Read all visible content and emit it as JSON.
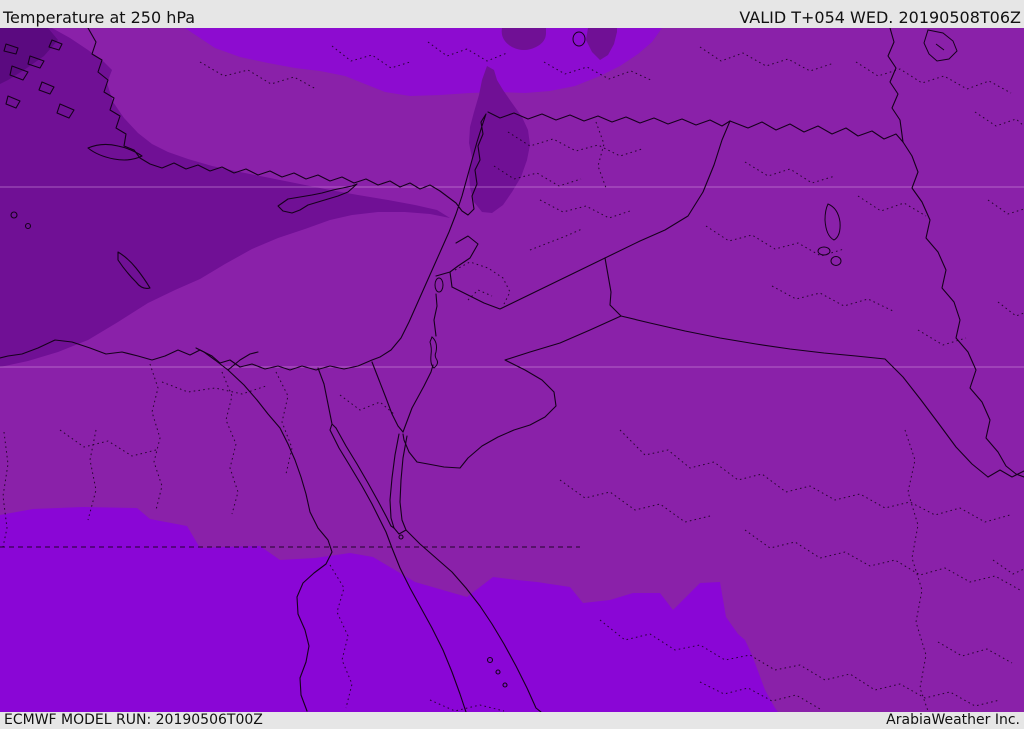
{
  "header": {
    "title": "Temperature at 250 hPa",
    "valid_label": "VALID T+054 WED. 20190508T06Z"
  },
  "footer": {
    "model_run_label": "ECMWF MODEL RUN: 20190506T00Z",
    "brand_label": "ArabiaWeather Inc."
  },
  "map": {
    "type": "temperature-contour-fill-map",
    "region": "Middle East / Eastern Mediterranean",
    "temperature_levels": [
      {
        "name": "darkest (coldest shown)",
        "color": "#5b0a80",
        "areas": "far northwest corner (Aegean)"
      },
      {
        "name": "dark",
        "color": "#701095",
        "areas": "NE Mediterranean wedge, western Syria blob, two small patches along northern edge"
      },
      {
        "name": "medium",
        "color": "#8a21a9",
        "areas": "most land: Levant, Iraq, north Saudi Arabia, north Egypt"
      },
      {
        "name": "bright north band",
        "color": "#8d0cd0",
        "areas": "strip across Turkey along top edge"
      },
      {
        "name": "bright south",
        "color": "#8a06d6",
        "areas": "southern Egypt, Sudan border area, south-west Saudi Arabia"
      }
    ]
  },
  "colors": {
    "bar_bg": "#e6e6e6",
    "bar_text": "#111111",
    "temp_medium": "#8a21a9",
    "temp_dark": "#701095",
    "temp_darkest": "#5b0a80",
    "temp_bright": "#8d0cd0",
    "temp_bright_south": "#8a06d6",
    "border_line": "#16001c",
    "graticule": "#d79ae0"
  }
}
